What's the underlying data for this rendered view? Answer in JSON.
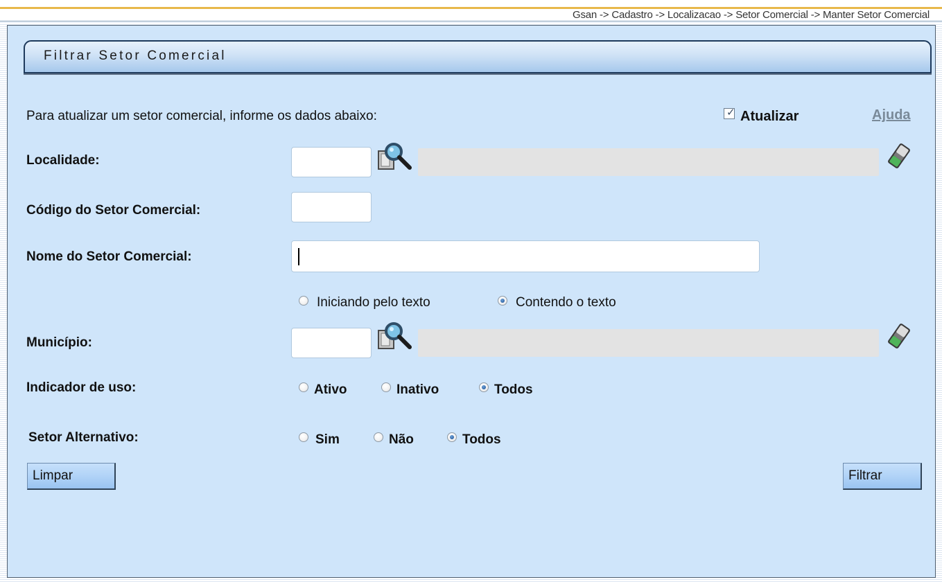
{
  "breadcrumb": "Gsan -> Cadastro -> Localizacao -> Setor Comercial -> Manter Setor Comercial",
  "panel": {
    "title": "Filtrar Setor Comercial",
    "intro": "Para atualizar um setor comercial, informe os dados abaixo:",
    "update_label": "Atualizar",
    "update_checked": true,
    "help_label": "Ajuda"
  },
  "fields": {
    "localidade": {
      "label": "Localidade:",
      "value": ""
    },
    "codigo": {
      "label": "Código do Setor Comercial:",
      "value": ""
    },
    "nome": {
      "label": "Nome do Setor Comercial:",
      "value": ""
    },
    "municipio": {
      "label": "Município:",
      "value": ""
    }
  },
  "search_mode": {
    "options": [
      "Iniciando pelo texto",
      "Contendo o texto"
    ],
    "selected": "Contendo o texto"
  },
  "indicador_uso": {
    "label": "Indicador de uso:",
    "options": [
      "Ativo",
      "Inativo",
      "Todos"
    ],
    "selected": "Todos"
  },
  "setor_alternativo": {
    "label": "Setor Alternativo:",
    "options": [
      "Sim",
      "Não",
      "Todos"
    ],
    "selected": "Todos"
  },
  "buttons": {
    "clear": "Limpar",
    "filter": "Filtrar"
  },
  "icons": {
    "search": "magnifier-icon",
    "clear_field": "eraser-icon"
  },
  "colors": {
    "panel_bg": "#cfe5fa",
    "header_top": "#e6f1fc",
    "header_bottom": "#a6c8ec",
    "button": "#b1d3f7"
  }
}
